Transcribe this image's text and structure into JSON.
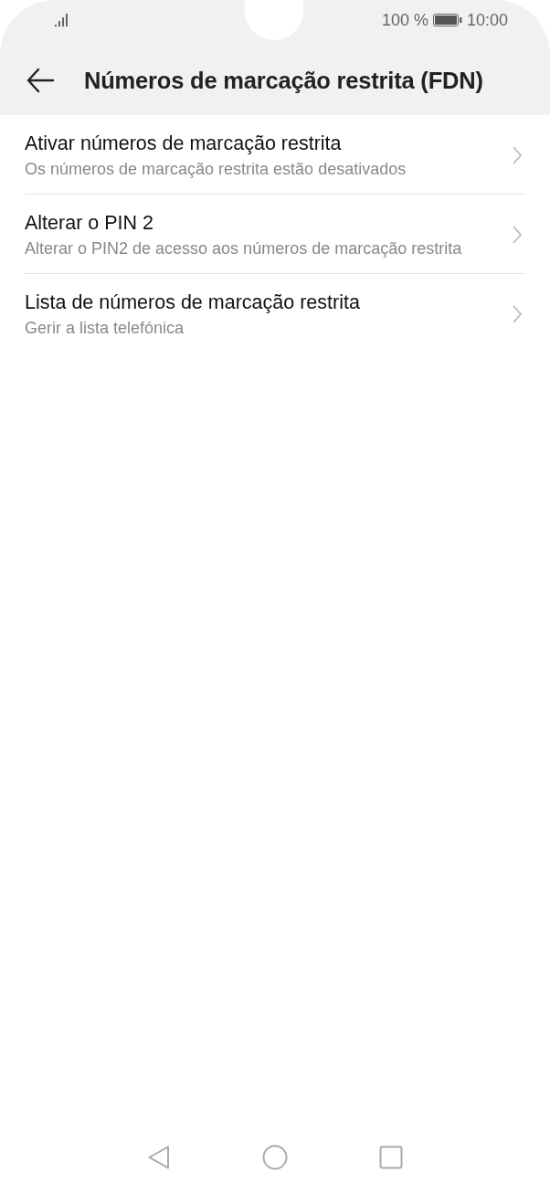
{
  "status_bar": {
    "battery_text": "100 %",
    "time": "10:00"
  },
  "header": {
    "title": "Números de marcação restrita (FDN)"
  },
  "items": [
    {
      "title": "Ativar números de marcação restrita",
      "subtitle": "Os números de marcação restrita estão desativados"
    },
    {
      "title": "Alterar o PIN 2",
      "subtitle": "Alterar o PIN2 de acesso aos números de marcação restrita"
    },
    {
      "title": "Lista de números de marcação restrita",
      "subtitle": "Gerir a lista telefónica"
    }
  ]
}
